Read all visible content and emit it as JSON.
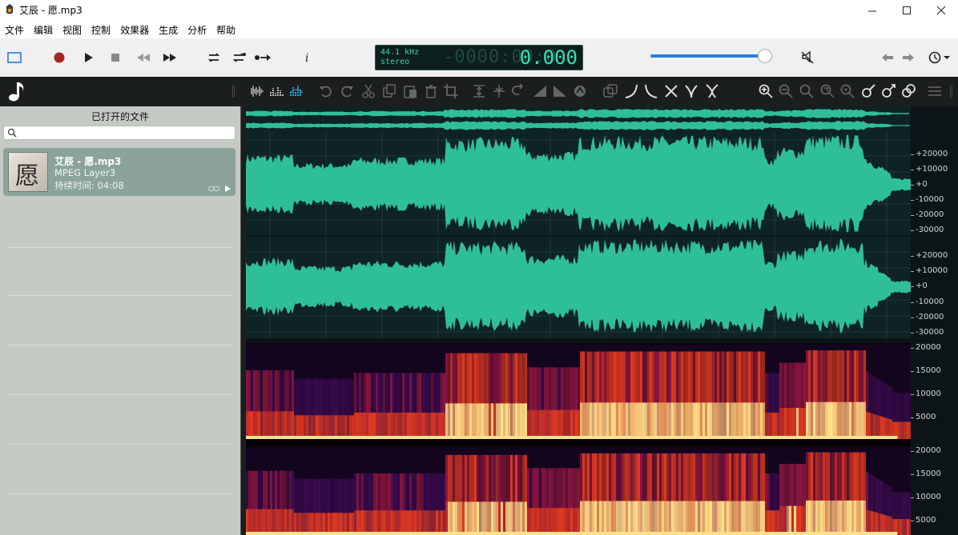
{
  "window": {
    "title": "艾辰 - 愿.mp3",
    "icons": {
      "app": "app-logo-icon",
      "minimize": "minimize-icon",
      "maximize": "maximize-icon",
      "close": "close-icon"
    }
  },
  "menu": {
    "items": [
      "文件",
      "编辑",
      "视图",
      "控制",
      "效果器",
      "生成",
      "分析",
      "帮助"
    ]
  },
  "transport": {
    "icons": [
      "view-toggle-icon",
      "record-icon",
      "play-icon",
      "stop-icon",
      "rewind-icon",
      "fast-forward-icon",
      "loop-icon",
      "loop-repeat-icon",
      "skip-selection-icon",
      "info-icon"
    ],
    "sample_rate": "44.1 kHz",
    "channels": "stereo",
    "ghost_time": "-0000:00:0",
    "time": "0.000",
    "volume_level": 0.95,
    "right_icons": [
      "mute-icon",
      "back-arrow-icon",
      "forward-arrow-icon",
      "history-icon"
    ]
  },
  "edit_toolbar": {
    "icons": [
      "waveform-view-icon",
      "spectrum-view-icon",
      "combined-view-icon",
      "undo-icon",
      "redo-icon",
      "cut-icon",
      "copy-icon",
      "paste-icon",
      "delete-icon",
      "crop-icon",
      "normalize-icon",
      "trim-icon",
      "reverse-icon",
      "fade-in-icon",
      "fade-out-icon",
      "silence-icon",
      "duplicate-icon",
      "curve-in-icon",
      "curve-out-icon",
      "crossfade-icon",
      "merge-icon",
      "split-icon",
      "zoom-in-icon",
      "zoom-out-icon",
      "zoom-fit-icon",
      "zoom-selection-icon",
      "zoom-reset-icon",
      "marker-icon",
      "marker-add-icon",
      "marker-link-icon",
      "list-icon"
    ]
  },
  "sidebar": {
    "header": "已打开的文件",
    "search_placeholder": "",
    "file": {
      "name": "艾辰 - 愿.mp3",
      "codec": "MPEG Layer3",
      "duration_label": "持续时间: 04:08",
      "cover_glyph": "愿"
    }
  },
  "waveform_axis": {
    "top_channel": [
      "+20000",
      "+10000",
      "+0",
      "-10000",
      "-20000",
      "-30000"
    ],
    "bottom_channel": [
      "+20000",
      "+10000",
      "+0",
      "-10000",
      "-20000",
      "-30000"
    ]
  },
  "spectrogram_axis": {
    "top_channel": [
      "20000",
      "15000",
      "10000",
      "5000"
    ],
    "bottom_channel": [
      "20000",
      "15000",
      "10000",
      "5000"
    ]
  },
  "colors": {
    "wave": "#2fbf98",
    "wave_bg": "#0e2326",
    "spectro_hot": "#ffe08a",
    "spectro_mid": "#e03a20",
    "spectro_low": "#3a0b4e",
    "accent": "#2a7fe0"
  }
}
